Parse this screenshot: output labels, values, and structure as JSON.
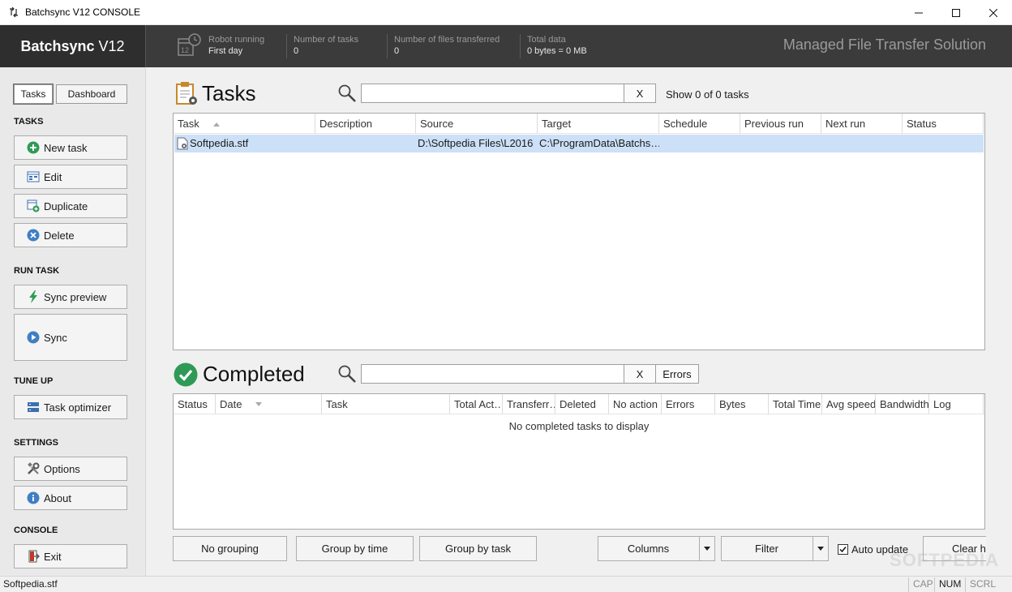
{
  "window": {
    "title": "Batchsync V12 CONSOLE"
  },
  "header": {
    "brand_bold": "Batchsync",
    "brand_version": "V12",
    "stats": [
      {
        "key": "Robot running",
        "value": "First day"
      },
      {
        "key": "Number of tasks",
        "value": "0"
      },
      {
        "key": "Number of files transferred",
        "value": "0"
      },
      {
        "key": "Total data",
        "value": "0 bytes = 0 MB"
      }
    ],
    "tagline": "Managed File Transfer Solution"
  },
  "sidebar": {
    "tabs": [
      "Tasks",
      "Dashboard"
    ],
    "sections": {
      "tasks": "TASKS",
      "run_task": "RUN TASK",
      "tune_up": "TUNE UP",
      "settings": "SETTINGS",
      "console": "CONSOLE"
    },
    "buttons": {
      "new_task": "New task",
      "edit": "Edit",
      "duplicate": "Duplicate",
      "delete": "Delete",
      "sync_preview": "Sync preview",
      "sync": "Sync",
      "task_optimizer": "Task optimizer",
      "options": "Options",
      "about": "About",
      "exit": "Exit"
    }
  },
  "tasks_panel": {
    "title": "Tasks",
    "search_value": "",
    "clear_label": "X",
    "show_count": "Show 0 of 0 tasks",
    "columns": [
      "Task",
      "Description",
      "Source",
      "Target",
      "Schedule",
      "Previous run",
      "Next run",
      "Status"
    ],
    "rows": [
      {
        "task": "Softpedia.stf",
        "description": "",
        "source": "D:\\Softpedia Files\\L2016",
        "target": "C:\\ProgramData\\Batchs…",
        "schedule": "",
        "previous_run": "",
        "next_run": "",
        "status": ""
      }
    ]
  },
  "completed_panel": {
    "title": "Completed",
    "search_value": "",
    "clear_label": "X",
    "errors_label": "Errors",
    "columns": [
      "Status",
      "Date",
      "Task",
      "Total Act…",
      "Transferr…",
      "Deleted",
      "No action",
      "Errors",
      "Bytes",
      "Total Time",
      "Avg speed",
      "Bandwidth",
      "Log"
    ],
    "empty_message": "No completed tasks to display"
  },
  "bottom_bar": {
    "no_grouping": "No grouping",
    "group_by_time": "Group by time",
    "group_by_task": "Group by task",
    "columns": "Columns",
    "filter": "Filter",
    "auto_update": "Auto update",
    "auto_update_checked": true,
    "clear": "Clear h"
  },
  "statusbar": {
    "text": "Softpedia.stf",
    "indicators": [
      "CAP",
      "NUM",
      "SCRL"
    ]
  },
  "watermark": "SOFTPEDIA",
  "colors": {
    "header_bg": "#3b3b3b",
    "selection": "#cce0f7",
    "completed_check": "#2e9a56"
  }
}
